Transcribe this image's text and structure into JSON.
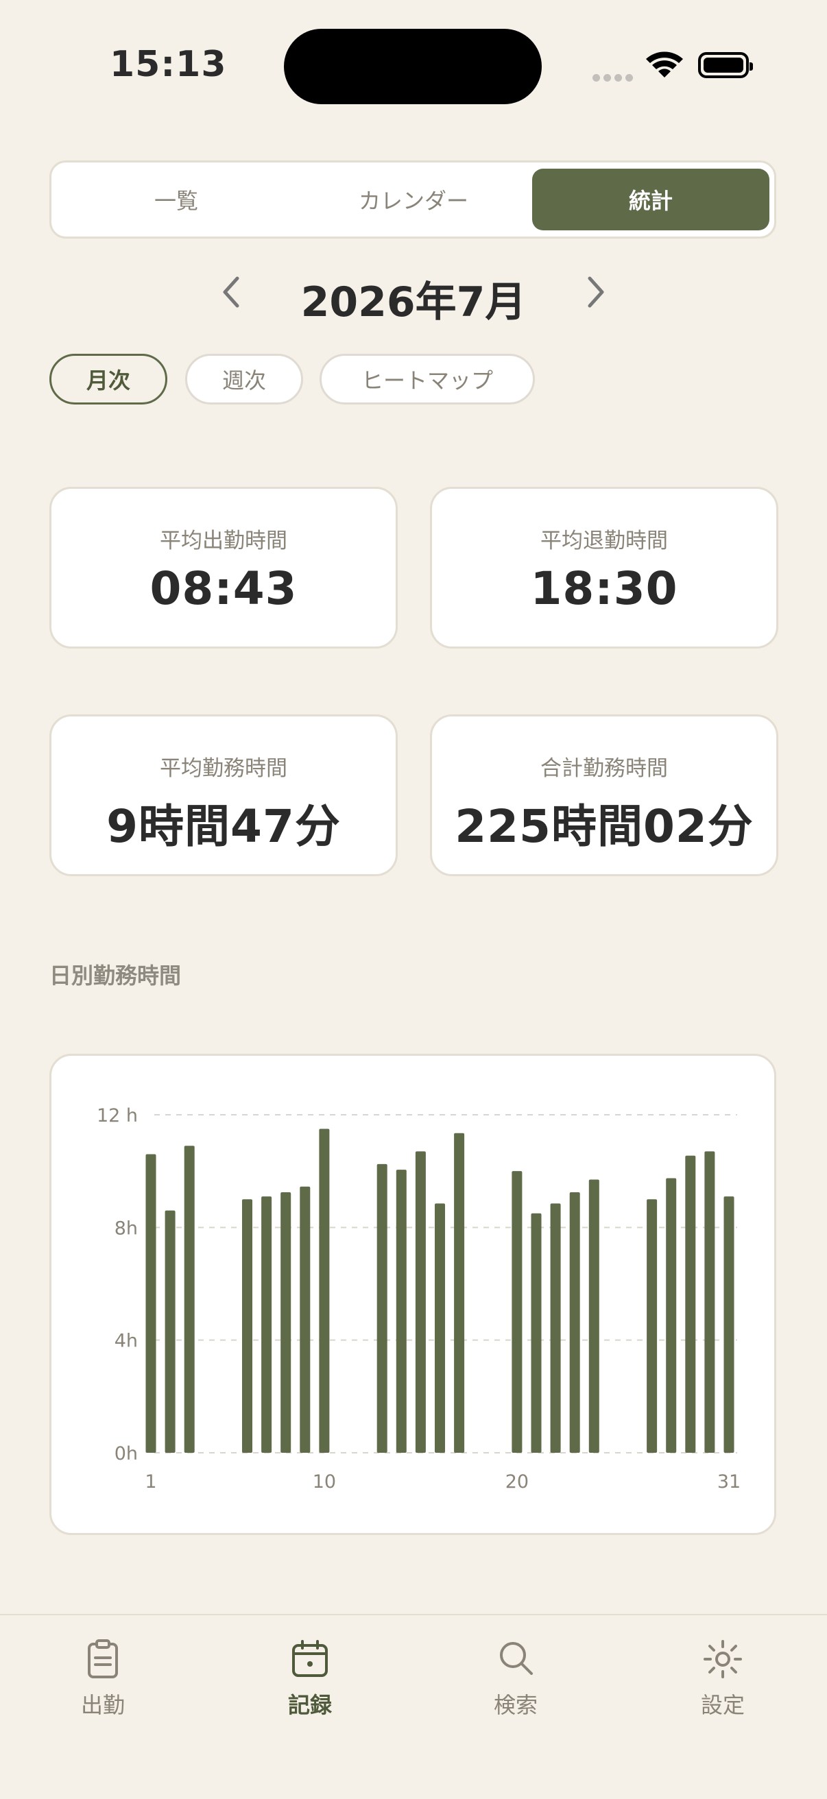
{
  "status_bar": {
    "time": "15:13"
  },
  "segmented": {
    "items": [
      "一覧",
      "カレンダー",
      "統計"
    ],
    "active_index": 2
  },
  "month_nav": {
    "title": "2026年7月"
  },
  "period_chips": {
    "items": [
      "月次",
      "週次",
      "ヒートマップ"
    ],
    "active_index": 0
  },
  "stats": [
    {
      "label": "平均出勤時間",
      "value": "08:43"
    },
    {
      "label": "平均退勤時間",
      "value": "18:30"
    },
    {
      "label": "平均勤務時間",
      "value": "9時間47分"
    },
    {
      "label": "合計勤務時間",
      "value": "225時間02分"
    }
  ],
  "chart_section": {
    "title": "日別勤務時間"
  },
  "chart_data": {
    "type": "bar",
    "x": [
      1,
      2,
      3,
      4,
      5,
      6,
      7,
      8,
      9,
      10,
      11,
      12,
      13,
      14,
      15,
      16,
      17,
      18,
      19,
      20,
      21,
      22,
      23,
      24,
      25,
      26,
      27,
      28,
      29,
      30,
      31
    ],
    "values": [
      10.6,
      8.6,
      10.9,
      0,
      0,
      9.0,
      9.1,
      9.25,
      9.45,
      11.5,
      0,
      0,
      10.25,
      10.05,
      10.7,
      8.85,
      11.35,
      0,
      0,
      10.0,
      8.5,
      8.85,
      9.25,
      9.7,
      0,
      0,
      9.0,
      9.75,
      10.55,
      10.7,
      9.1
    ],
    "ylim": [
      0,
      12
    ],
    "y_ticks": [
      {
        "value": 0,
        "label": "0h"
      },
      {
        "value": 4,
        "label": "4h"
      },
      {
        "value": 8,
        "label": "8h"
      },
      {
        "value": 12,
        "label": "12 h"
      }
    ],
    "x_ticks": [
      {
        "value": 1,
        "label": "1"
      },
      {
        "value": 10,
        "label": "10"
      },
      {
        "value": 20,
        "label": "20"
      },
      {
        "value": 31,
        "label": "31"
      }
    ],
    "grid": true,
    "bar_color": "#5E6A48"
  },
  "tabbar": {
    "items": [
      {
        "label": "出勤",
        "icon": "clipboard-icon"
      },
      {
        "label": "記録",
        "icon": "calendar-icon"
      },
      {
        "label": "検索",
        "icon": "search-icon"
      },
      {
        "label": "設定",
        "icon": "gear-icon"
      }
    ],
    "active_index": 1
  },
  "colors": {
    "accent": "#5E6A48",
    "background": "#F5F0E8"
  }
}
